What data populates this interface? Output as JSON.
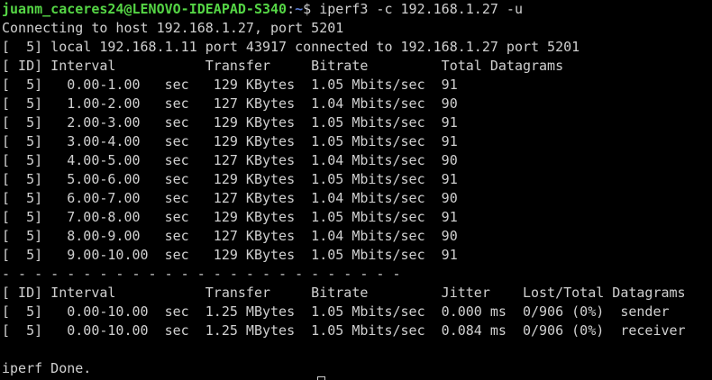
{
  "prompt": {
    "user_host": "juanm_caceres24@LENOVO-IDEAPAD-S340",
    "separator": ":",
    "path": "~",
    "symbol": "$ ",
    "command": "iperf3 -c 192.168.1.27 -u"
  },
  "output": {
    "connecting": "Connecting to host 192.168.1.27, port 5201",
    "local": "[  5] local 192.168.1.11 port 43917 connected to 192.168.1.27 port 5201",
    "header1": "[ ID] Interval           Transfer     Bitrate         Total Datagrams",
    "intervals": [
      "[  5]   0.00-1.00   sec   129 KBytes  1.05 Mbits/sec  91",
      "[  5]   1.00-2.00   sec   127 KBytes  1.04 Mbits/sec  90",
      "[  5]   2.00-3.00   sec   129 KBytes  1.05 Mbits/sec  91",
      "[  5]   3.00-4.00   sec   129 KBytes  1.05 Mbits/sec  91",
      "[  5]   4.00-5.00   sec   127 KBytes  1.04 Mbits/sec  90",
      "[  5]   5.00-6.00   sec   129 KBytes  1.05 Mbits/sec  91",
      "[  5]   6.00-7.00   sec   127 KBytes  1.04 Mbits/sec  90",
      "[  5]   7.00-8.00   sec   129 KBytes  1.05 Mbits/sec  91",
      "[  5]   8.00-9.00   sec   127 KBytes  1.04 Mbits/sec  90",
      "[  5]   9.00-10.00  sec   129 KBytes  1.05 Mbits/sec  91"
    ],
    "divider": "- - - - - - - - - - - - - - - - - - - - - - - - -",
    "header2": "[ ID] Interval           Transfer     Bitrate         Jitter    Lost/Total Datagrams",
    "summary": [
      "[  5]   0.00-10.00  sec  1.25 MBytes  1.05 Mbits/sec  0.000 ms  0/906 (0%)  sender",
      "[  5]   0.00-10.00  sec  1.25 MBytes  1.05 Mbits/sec  0.084 ms  0/906 (0%)  receiver"
    ],
    "blank": "",
    "done": "iperf Done."
  },
  "colors": {
    "background": "#000000",
    "text": "#d0d0d0",
    "user_host": "#55d545",
    "path": "#5a7ad0"
  }
}
